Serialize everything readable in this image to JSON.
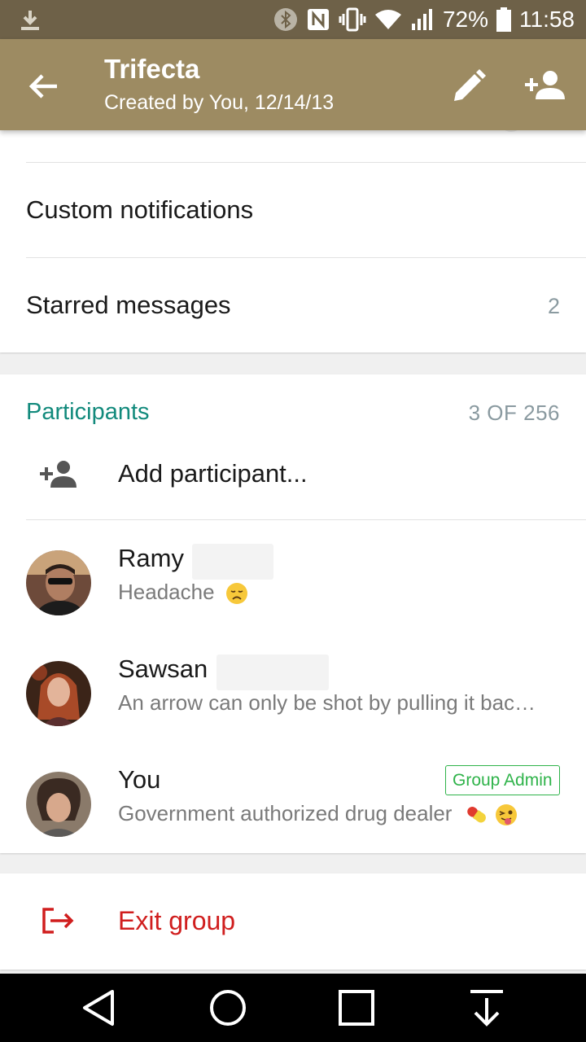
{
  "status_bar": {
    "battery": "72%",
    "time": "11:58",
    "icons": [
      "download-icon",
      "bluetooth-icon",
      "nfc-icon",
      "vibrate-icon",
      "wifi-icon",
      "signal-icon",
      "battery-icon"
    ]
  },
  "app_bar": {
    "title": "Trifecta",
    "subtitle": "Created by You, 12/14/13",
    "icons": [
      "back-arrow-icon",
      "edit-pencil-icon",
      "add-person-icon"
    ],
    "color": "#9d8b62"
  },
  "settings": {
    "custom_notifications": "Custom notifications",
    "starred_messages": "Starred messages",
    "starred_count": "2"
  },
  "participants": {
    "title": "Participants",
    "count": "3 OF 256",
    "add_label": "Add participant...",
    "accent": "#128a7c",
    "items": [
      {
        "name": "Ramy",
        "status": "Headache",
        "emoji": "disappointed-face",
        "admin": ""
      },
      {
        "name": "Sawsan",
        "status": "An arrow can only be shot by pulling it bac…",
        "emoji": "",
        "admin": ""
      },
      {
        "name": "You",
        "status": "Government authorized drug dealer",
        "emoji": "pill-and-winking-tongue-face",
        "admin": "Group Admin"
      }
    ]
  },
  "exit": {
    "label": "Exit group",
    "color": "#d01e1e"
  },
  "nav_bar": {
    "buttons": [
      "back-triangle-icon",
      "home-circle-icon",
      "recents-square-icon",
      "notification-pull-icon"
    ]
  }
}
